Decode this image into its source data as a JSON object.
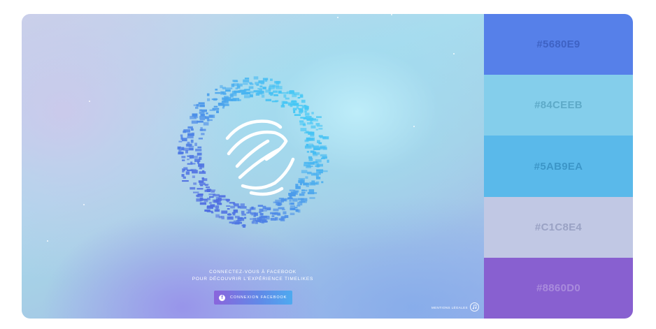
{
  "hero": {
    "tagline_line1": "CONNECTEZ-VOUS À FACEBOOK",
    "tagline_line2": "POUR DÉCOUVRIR L'EXPÉRIENCE TIMELIKES",
    "facebook_button_label": "CONNEXION FACEBOOK",
    "facebook_icon_glyph": "f",
    "legal_link_label": "MENTIONS LÉGALES",
    "logo_icon": "timelikes-logo-icon",
    "music_icon": "music-note-icon"
  },
  "palette": {
    "swatches": [
      {
        "label": "#5680E9",
        "color": "#5680E9",
        "text_color": "#3e62c4"
      },
      {
        "label": "#84CEEB",
        "color": "#84CEEB",
        "text_color": "#5eaac8"
      },
      {
        "label": "#5AB9EA",
        "color": "#5AB9EA",
        "text_color": "#3c96c8"
      },
      {
        "label": "#C1C8E4",
        "color": "#C1C8E4",
        "text_color": "#9aa2c4"
      },
      {
        "label": "#8860D0",
        "color": "#8860D0",
        "text_color": "#a98bdc"
      }
    ]
  }
}
